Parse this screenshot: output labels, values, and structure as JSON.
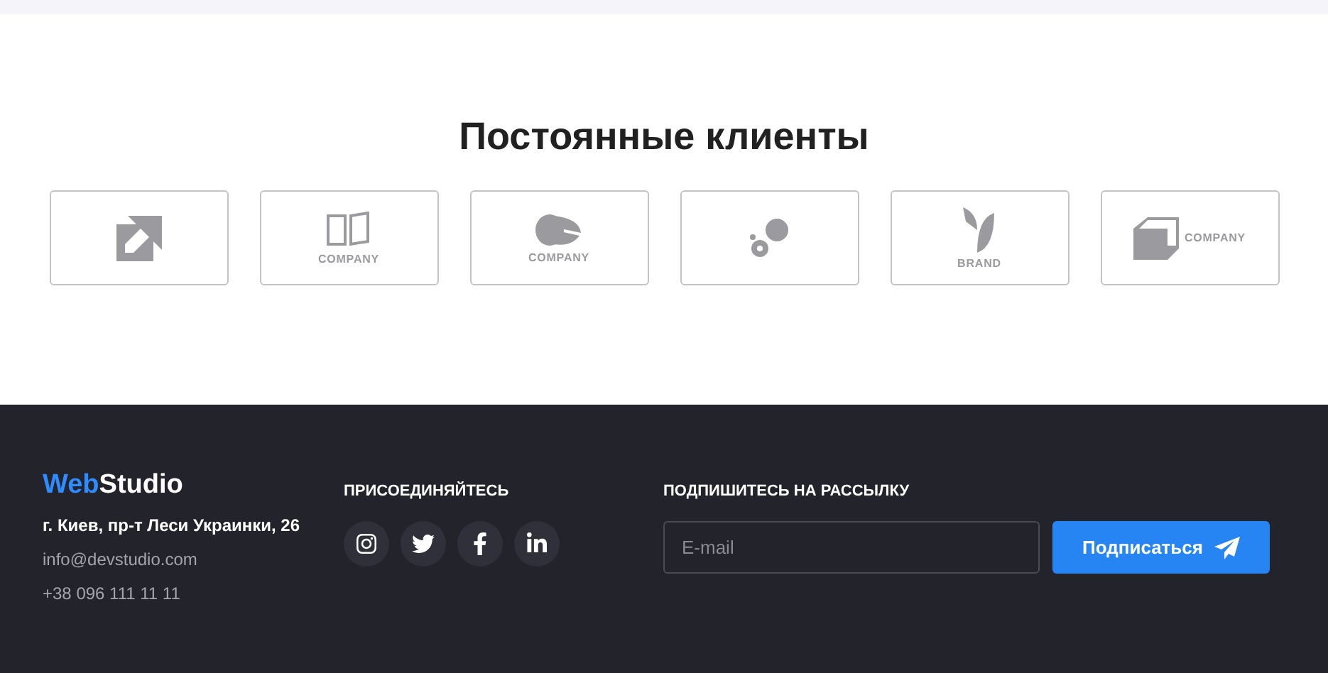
{
  "clients": {
    "title": "Постоянные клиенты",
    "logos": [
      {
        "kind": "squares"
      },
      {
        "kind": "book",
        "wordmark": "COMPANY"
      },
      {
        "kind": "shell",
        "wordmark": "COMPANY"
      },
      {
        "kind": "blob"
      },
      {
        "kind": "leaf",
        "wordmark": "BRAND"
      },
      {
        "kind": "cube",
        "wordmark": "COMPANY"
      }
    ]
  },
  "footer": {
    "brand": {
      "accent": "Web",
      "rest": "Studio"
    },
    "address": "г. Киев, пр-т Леси Украинки, 26",
    "email": "info@devstudio.com",
    "phone": "+38 096 111 11 11",
    "social": {
      "title": "ПРИСОЕДИНЯЙТЕСЬ",
      "links": [
        {
          "kind": "instagram"
        },
        {
          "kind": "twitter"
        },
        {
          "kind": "facebook"
        },
        {
          "kind": "linkedin"
        }
      ]
    },
    "subscribe": {
      "title": "ПОДПИШИТЕСЬ НА РАССЫЛКУ",
      "placeholder": "E-mail",
      "button": "Подписаться"
    }
  }
}
